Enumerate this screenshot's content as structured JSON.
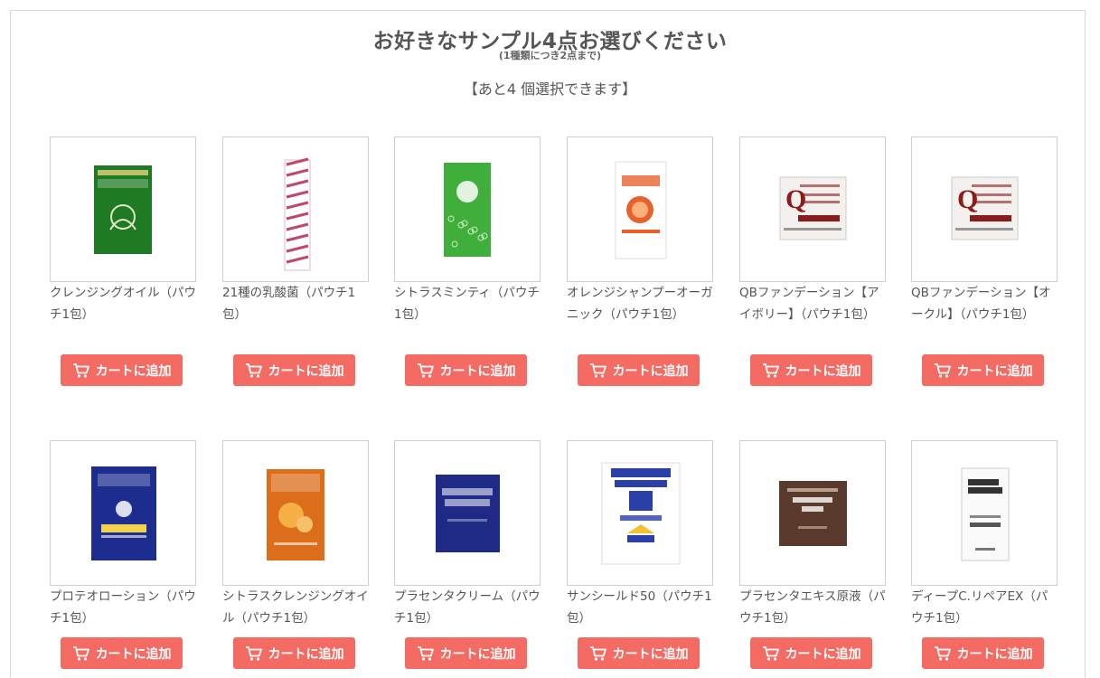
{
  "header": {
    "title": "お好きなサンプル4点お選びください",
    "subtitle": "(1種類につき2点まで)",
    "remaining": "【あと4 個選択できます】"
  },
  "cart_button_label": "カートに追加",
  "products": [
    {
      "name": "クレンジングオイル（パウチ1包）",
      "image": "green-cleansing-oil-pouch",
      "pack_color": "#1f7a24"
    },
    {
      "name": "21種の乳酸菌（パウチ1包）",
      "image": "pink-lactic-acid-stick",
      "pack_color": "#c2456a"
    },
    {
      "name": "シトラスミンティ（パウチ1包）",
      "image": "green-citrus-minty-pouch",
      "pack_color": "#3fae3a"
    },
    {
      "name": "オレンジシャンプーオーガニック（パウチ1包）",
      "image": "orange-shampoo-pouch",
      "pack_color": "#e8612d"
    },
    {
      "name": "QBファンデーション【アイボリー】（パウチ1包）",
      "image": "qb-foundation-ivory-pouch",
      "pack_color": "#8b1c1c"
    },
    {
      "name": "QBファンデーション【オークル】（パウチ1包）",
      "image": "qb-foundation-ochre-pouch",
      "pack_color": "#8b1c1c"
    },
    {
      "name": "プロテオローション（パウチ1包）",
      "image": "navy-proteo-lotion-pouch",
      "pack_color": "#1d2c8f"
    },
    {
      "name": "シトラスクレンジングオイル（パウチ1包）",
      "image": "orange-citrus-cleansing-pouch",
      "pack_color": "#dc6d1b"
    },
    {
      "name": "プラセンタクリーム（パウチ1包）",
      "image": "navy-placenta-cream-pouch",
      "pack_color": "#1e2a86"
    },
    {
      "name": "サンシールド50（パウチ1包）",
      "image": "white-sun-shield-pouch",
      "pack_color": "#2b3fa8"
    },
    {
      "name": "プラセンタエキス原液（パウチ1包）",
      "image": "brown-placenta-extract-pouch",
      "pack_color": "#5a3a2c"
    },
    {
      "name": "ディープC.リペアEX（パウチ1包）",
      "image": "white-deep-c-repair-pouch",
      "pack_color": "#333333"
    }
  ]
}
